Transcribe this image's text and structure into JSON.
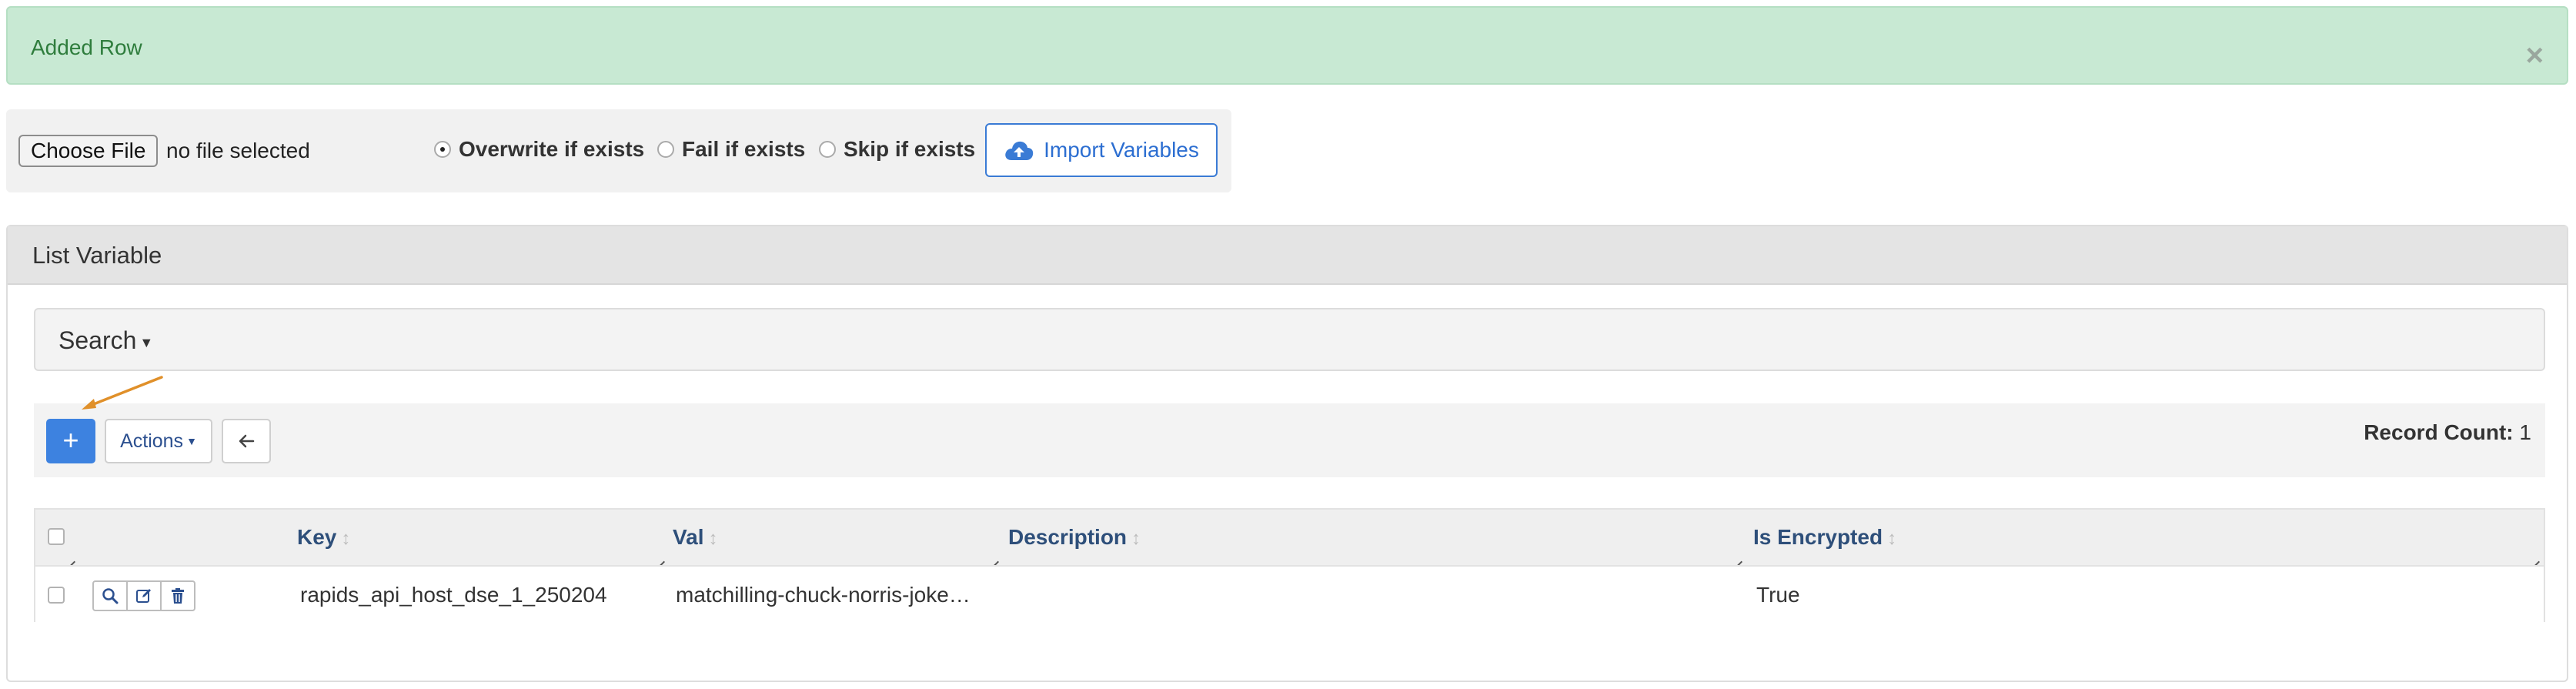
{
  "alert": {
    "message": "Added Row",
    "close_symbol": "×"
  },
  "import": {
    "choose_file_label": "Choose File",
    "file_status": "no file selected",
    "options": [
      {
        "label": "Overwrite if exists",
        "selected": true
      },
      {
        "label": "Fail if exists",
        "selected": false
      },
      {
        "label": "Skip if exists",
        "selected": false
      }
    ],
    "import_button_label": "Import Variables",
    "import_icon": "cloud-upload-icon"
  },
  "panel": {
    "title": "List Variable",
    "search_label": "Search",
    "toolbar": {
      "add_label": "+",
      "actions_label": "Actions",
      "back_icon": "arrow-left-icon",
      "record_count_label": "Record Count:",
      "record_count_value": "1"
    },
    "table": {
      "columns": [
        "Key",
        "Val",
        "Description",
        "Is Encrypted"
      ],
      "sort_symbol": "↕",
      "rows": [
        {
          "key": "rapids_api_host_dse_1_250204",
          "val": "matchilling-chuck-norris-joke…",
          "description": "",
          "is_encrypted": "True"
        }
      ]
    }
  },
  "colors": {
    "alert_bg": "#c8e9d3",
    "alert_text": "#2f7d3d",
    "primary": "#3d82e0",
    "header_text": "#2e4f7a",
    "annotation_arrow": "#e0902a"
  }
}
